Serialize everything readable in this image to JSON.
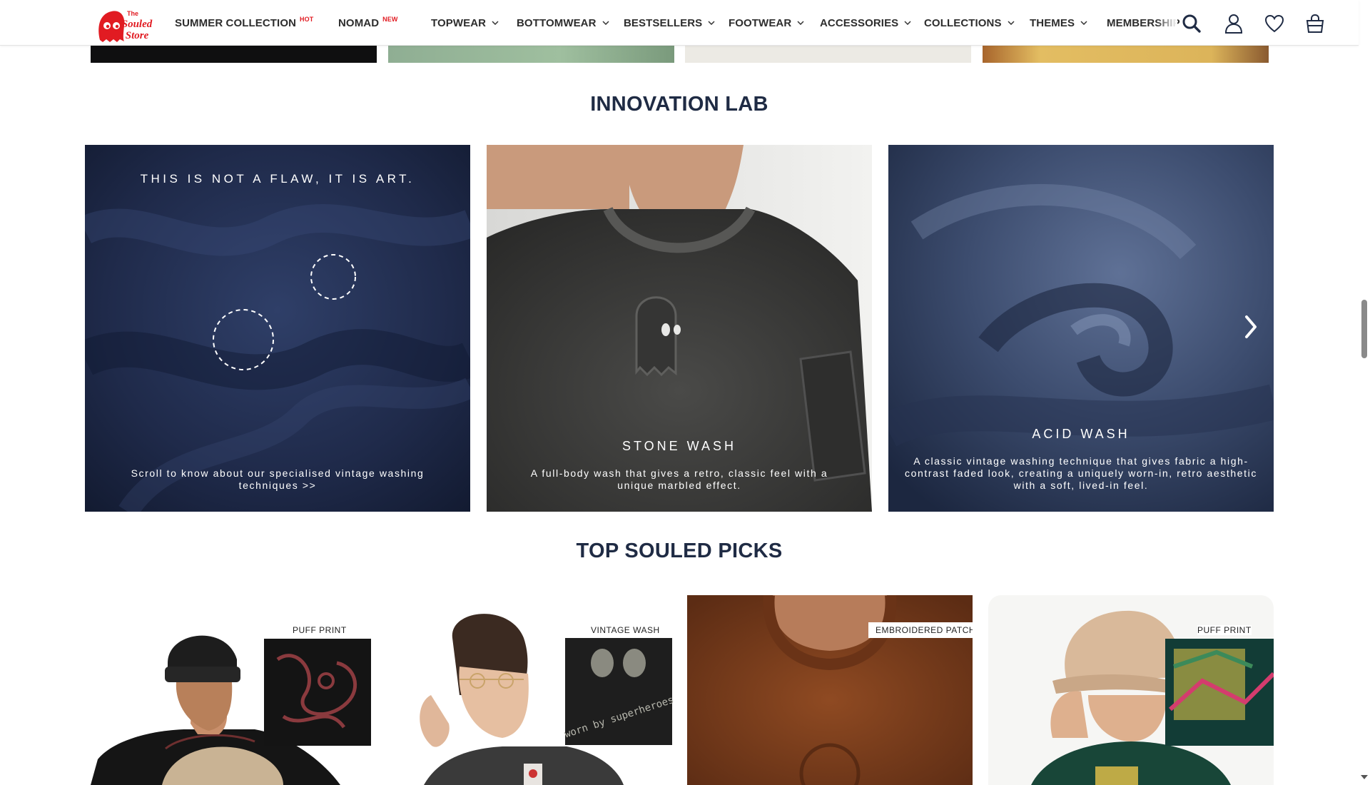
{
  "header": {
    "logo_text_1": "The",
    "logo_text_2": "Souled",
    "logo_text_3": "Store",
    "nav": [
      {
        "label": "SUMMER COLLECTION",
        "badge": "HOT"
      },
      {
        "label": "NOMAD",
        "badge": "NEW"
      },
      {
        "label": "TOPWEAR"
      },
      {
        "label": "BOTTOMWEAR"
      },
      {
        "label": "BESTSELLERS"
      },
      {
        "label": "FOOTWEAR"
      },
      {
        "label": "ACCESSORIES"
      },
      {
        "label": "COLLECTIONS"
      },
      {
        "label": "THEMES"
      },
      {
        "label": "MEMBERSHIP"
      }
    ],
    "icons": [
      "search-icon",
      "user-icon",
      "heart-icon",
      "bag-icon"
    ]
  },
  "innovation": {
    "title": "INNOVATION LAB",
    "cards": [
      {
        "tagline": "THIS IS NOT A FLAW, IT IS ART.",
        "desc": "Scroll to know about our specialised vintage washing techniques >>"
      },
      {
        "title": "STONE WASH",
        "desc": "A full-body wash that gives a retro, classic feel with a unique marbled effect."
      },
      {
        "title": "ACID WASH",
        "desc": "A classic vintage washing technique that gives fabric a high-contrast faded look, creating a uniquely worn-in, retro aesthetic with a soft, lived-in feel."
      }
    ]
  },
  "picks": {
    "title": "TOP SOULED PICKS",
    "items": [
      {
        "label": "PUFF PRINT"
      },
      {
        "label": "VINTAGE WASH",
        "print_text": "worn by superheroes"
      },
      {
        "label": "EMBROIDERED PATCH"
      },
      {
        "label": "PUFF PRINT"
      }
    ]
  },
  "colors": {
    "navy_text": "#1f2b44",
    "badge_red": "#e11b22",
    "logo_red": "#e11b22"
  }
}
